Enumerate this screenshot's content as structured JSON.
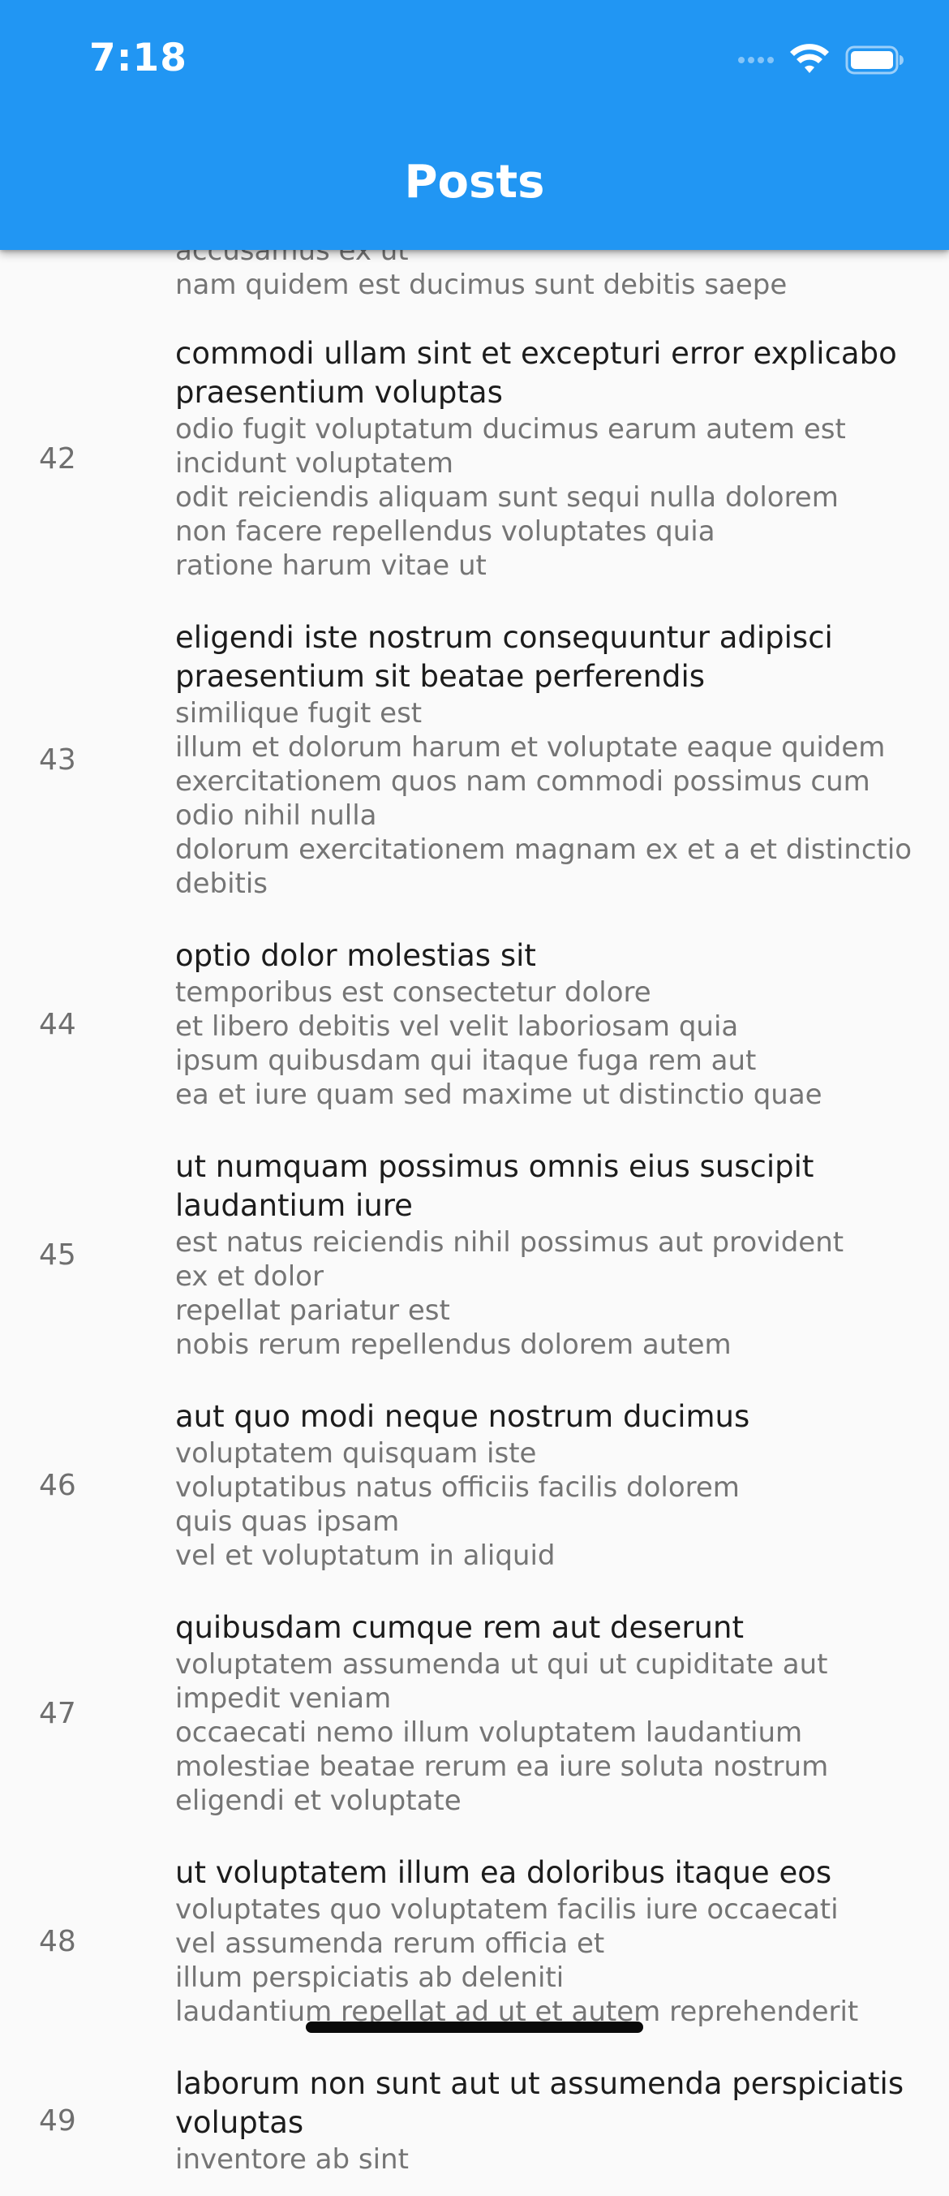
{
  "status_bar": {
    "time": "7:18"
  },
  "app_bar": {
    "title": "Posts",
    "background": "#2196f3"
  },
  "list": {
    "partial_top": {
      "body": "accusamus ex ut\nnam quidem est ducimus sunt debitis saepe"
    },
    "items": [
      {
        "number": "42",
        "title": "commodi ullam sint et excepturi error explicabo praesentium voluptas",
        "body": "odio fugit voluptatum ducimus earum autem est incidunt voluptatem\nodit reiciendis aliquam sunt sequi nulla dolorem\nnon facere repellendus voluptates quia\nratione harum vitae ut"
      },
      {
        "number": "43",
        "title": "eligendi iste nostrum consequuntur adipisci praesentium sit beatae perferendis",
        "body": "similique fugit est\nillum et dolorum harum et voluptate eaque quidem\nexercitationem quos nam commodi possimus cum odio nihil nulla\ndolorum exercitationem magnam ex et a et distinctio debitis"
      },
      {
        "number": "44",
        "title": "optio dolor molestias sit",
        "body": "temporibus est consectetur dolore\net libero debitis vel velit laboriosam quia\nipsum quibusdam qui itaque fuga rem aut\nea et iure quam sed maxime ut distinctio quae"
      },
      {
        "number": "45",
        "title": "ut numquam possimus omnis eius suscipit laudantium iure",
        "body": "est natus reiciendis nihil possimus aut provident\nex et dolor\nrepellat pariatur est\nnobis rerum repellendus dolorem autem"
      },
      {
        "number": "46",
        "title": "aut quo modi neque nostrum ducimus",
        "body": "voluptatem quisquam iste\nvoluptatibus natus officiis facilis dolorem\nquis quas ipsam\nvel et voluptatum in aliquid"
      },
      {
        "number": "47",
        "title": "quibusdam cumque rem aut deserunt",
        "body": "voluptatem assumenda ut qui ut cupiditate aut impedit veniam\noccaecati nemo illum voluptatem laudantium\nmolestiae beatae rerum ea iure soluta nostrum\neligendi et voluptate"
      },
      {
        "number": "48",
        "title": "ut voluptatem illum ea doloribus itaque eos",
        "body": "voluptates quo voluptatem facilis iure occaecati\nvel assumenda rerum officia et\nillum perspiciatis ab deleniti\nlaudantium repellat ad ut et autem reprehenderit"
      },
      {
        "number": "49",
        "title": "laborum non sunt aut ut assumenda perspiciatis voluptas",
        "body": "inventore ab sint"
      }
    ]
  }
}
